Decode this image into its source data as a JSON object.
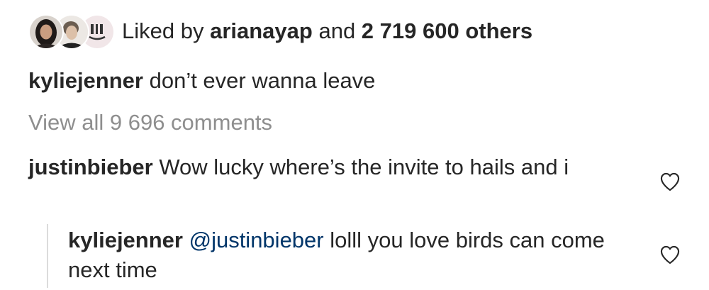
{
  "likes": {
    "prefix": "Liked by ",
    "user": "arianayap",
    "connector": " and ",
    "count": "2 719 600 others"
  },
  "caption": {
    "username": "kyliejenner",
    "text": " don’t ever wanna leave"
  },
  "view_all": "View all 9 696 comments",
  "comment": {
    "username": "justinbieber",
    "text": " Wow lucky where’s the invite to hails and i",
    "like_icon": "heart-outline-icon"
  },
  "reply": {
    "username": "kyliejenner",
    "mention": " @justinbieber",
    "text": " lolll you love birds can come next time",
    "like_icon": "heart-outline-icon"
  },
  "colors": {
    "text": "#262626",
    "muted": "#8e8e8e",
    "mention": "#003569",
    "divider": "#dbdbdb"
  }
}
